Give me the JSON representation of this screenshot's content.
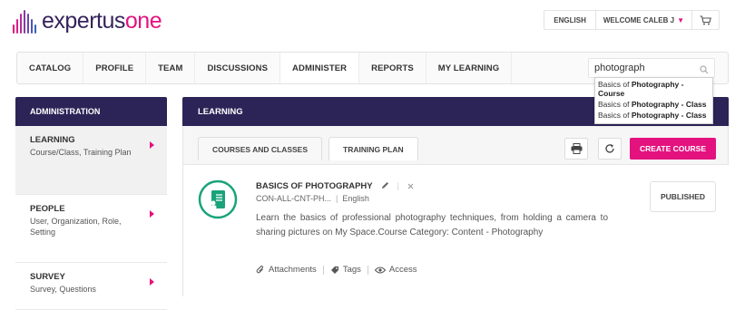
{
  "brand": {
    "name_part1": "expertus",
    "name_part2": "one",
    "colors": {
      "navy": "#2c2457",
      "magenta": "#e3127f",
      "teal": "#1aa37a"
    }
  },
  "topbar": {
    "language": "ENGLISH",
    "welcome": "WELCOME CALEB J",
    "caret_icon": "caret-down-icon",
    "cart_icon": "cart-icon"
  },
  "nav": {
    "items": [
      {
        "label": "CATALOG"
      },
      {
        "label": "PROFILE"
      },
      {
        "label": "TEAM"
      },
      {
        "label": "DISCUSSIONS"
      },
      {
        "label": "ADMINISTER"
      },
      {
        "label": "REPORTS"
      },
      {
        "label": "MY LEARNING"
      }
    ],
    "active_item": "ADMINISTER"
  },
  "search": {
    "value": "photograph",
    "icon": "search-icon",
    "suggestions": [
      {
        "prefix": "Basics of ",
        "match": "Photography",
        "suffix": " - Course"
      },
      {
        "prefix": "Basics of ",
        "match": "Photography",
        "suffix": " - Class"
      },
      {
        "prefix": "Basics of ",
        "match": "Photography",
        "suffix": " - Class"
      }
    ]
  },
  "sidebar": {
    "header": "ADMINISTRATION",
    "items": [
      {
        "title": "LEARNING",
        "desc": "Course/Class, Training Plan"
      },
      {
        "title": "PEOPLE",
        "desc": "User, Organization, Role, Setting"
      },
      {
        "title": "SURVEY",
        "desc": "Survey, Questions"
      }
    ]
  },
  "main": {
    "header": "LEARNING",
    "tabs": [
      {
        "label": "COURSES AND CLASSES"
      },
      {
        "label": "TRAINING PLAN"
      }
    ],
    "create_button": "CREATE COURSE",
    "course": {
      "title": "BASICS OF PHOTOGRAPHY",
      "code": "CON-ALL-CNT-PH...",
      "language": "English",
      "description": "Learn the basics of professional photography techniques, from holding a camera to sharing pictures on My Space.Course Category: Content - Photography",
      "status": "PUBLISHED",
      "actions": {
        "attachments": "Attachments",
        "tags": "Tags",
        "access": "Access"
      }
    }
  }
}
